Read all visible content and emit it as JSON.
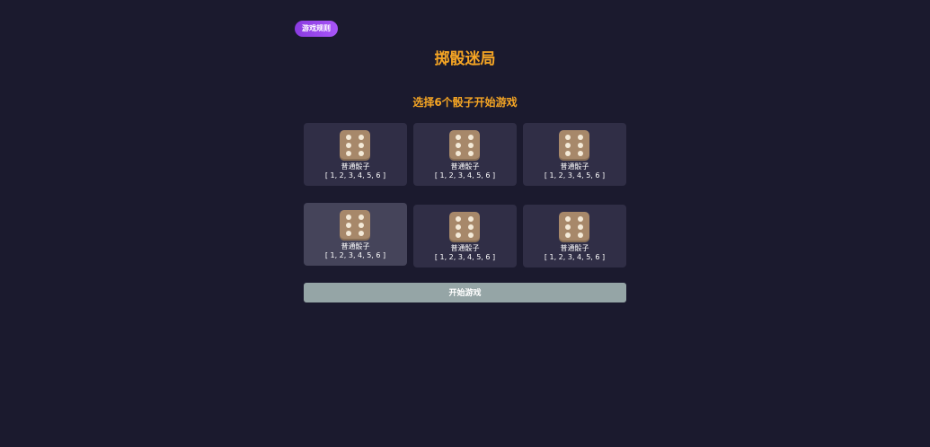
{
  "header": {
    "rules_label": "游戏规则",
    "title": "掷骰迷局"
  },
  "selection": {
    "prompt": "选择6个骰子开始游戏"
  },
  "dice": [
    {
      "name": "普通骰子",
      "faces": "[ 1, 2, 3, 4, 5, 6 ]",
      "icon": "die-six-icon"
    },
    {
      "name": "普通骰子",
      "faces": "[ 1, 2, 3, 4, 5, 6 ]",
      "icon": "die-six-icon"
    },
    {
      "name": "普通骰子",
      "faces": "[ 1, 2, 3, 4, 5, 6 ]",
      "icon": "die-six-icon"
    },
    {
      "name": "普通骰子",
      "faces": "[ 1, 2, 3, 4, 5, 6 ]",
      "icon": "die-six-icon"
    },
    {
      "name": "普通骰子",
      "faces": "[ 1, 2, 3, 4, 5, 6 ]",
      "icon": "die-six-icon"
    },
    {
      "name": "普通骰子",
      "faces": "[ 1, 2, 3, 4, 5, 6 ]",
      "icon": "die-six-icon"
    }
  ],
  "actions": {
    "start_label": "开始游戏"
  },
  "colors": {
    "background": "#1b1a2e",
    "accent": "#f5a524",
    "card": "#302e46",
    "card_hover": "#45445a",
    "die": "#a7886a",
    "start_disabled": "#95a5a6",
    "rules_button": "#9333ea"
  }
}
